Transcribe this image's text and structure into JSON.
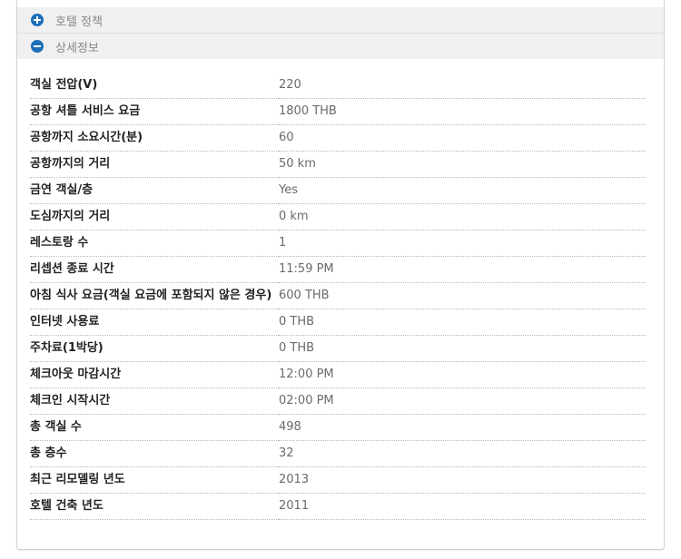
{
  "sections": {
    "policy": {
      "title": "호텔 정책",
      "icon": "plus-circle-icon"
    },
    "details": {
      "title": "상세정보",
      "icon": "minus-circle-icon"
    }
  },
  "accent_color": "#1c6fb8",
  "rows": [
    {
      "label": "객실 전압(V)",
      "value": "220"
    },
    {
      "label": "공항 셔틀 서비스 요금",
      "value": "1800 THB"
    },
    {
      "label": "공항까지 소요시간(분)",
      "value": "60"
    },
    {
      "label": "공항까지의 거리",
      "value": "50 km"
    },
    {
      "label": "금연 객실/층",
      "value": "Yes"
    },
    {
      "label": "도심까지의 거리",
      "value": "0 km"
    },
    {
      "label": "레스토랑 수",
      "value": "1"
    },
    {
      "label": "리셉션 종료 시간",
      "value": "11:59 PM"
    },
    {
      "label": "아침 식사 요금(객실 요금에 포함되지 않은 경우)",
      "value": "600 THB"
    },
    {
      "label": "인터넷 사용료",
      "value": "0 THB"
    },
    {
      "label": "주차료(1박당)",
      "value": "0 THB"
    },
    {
      "label": "체크아웃 마감시간",
      "value": "12:00 PM"
    },
    {
      "label": "체크인 시작시간",
      "value": "02:00 PM"
    },
    {
      "label": "총 객실 수",
      "value": "498"
    },
    {
      "label": "총 층수",
      "value": "32"
    },
    {
      "label": "최근 리모델링 년도",
      "value": "2013"
    },
    {
      "label": "호텔 건축 년도",
      "value": "2011"
    }
  ]
}
